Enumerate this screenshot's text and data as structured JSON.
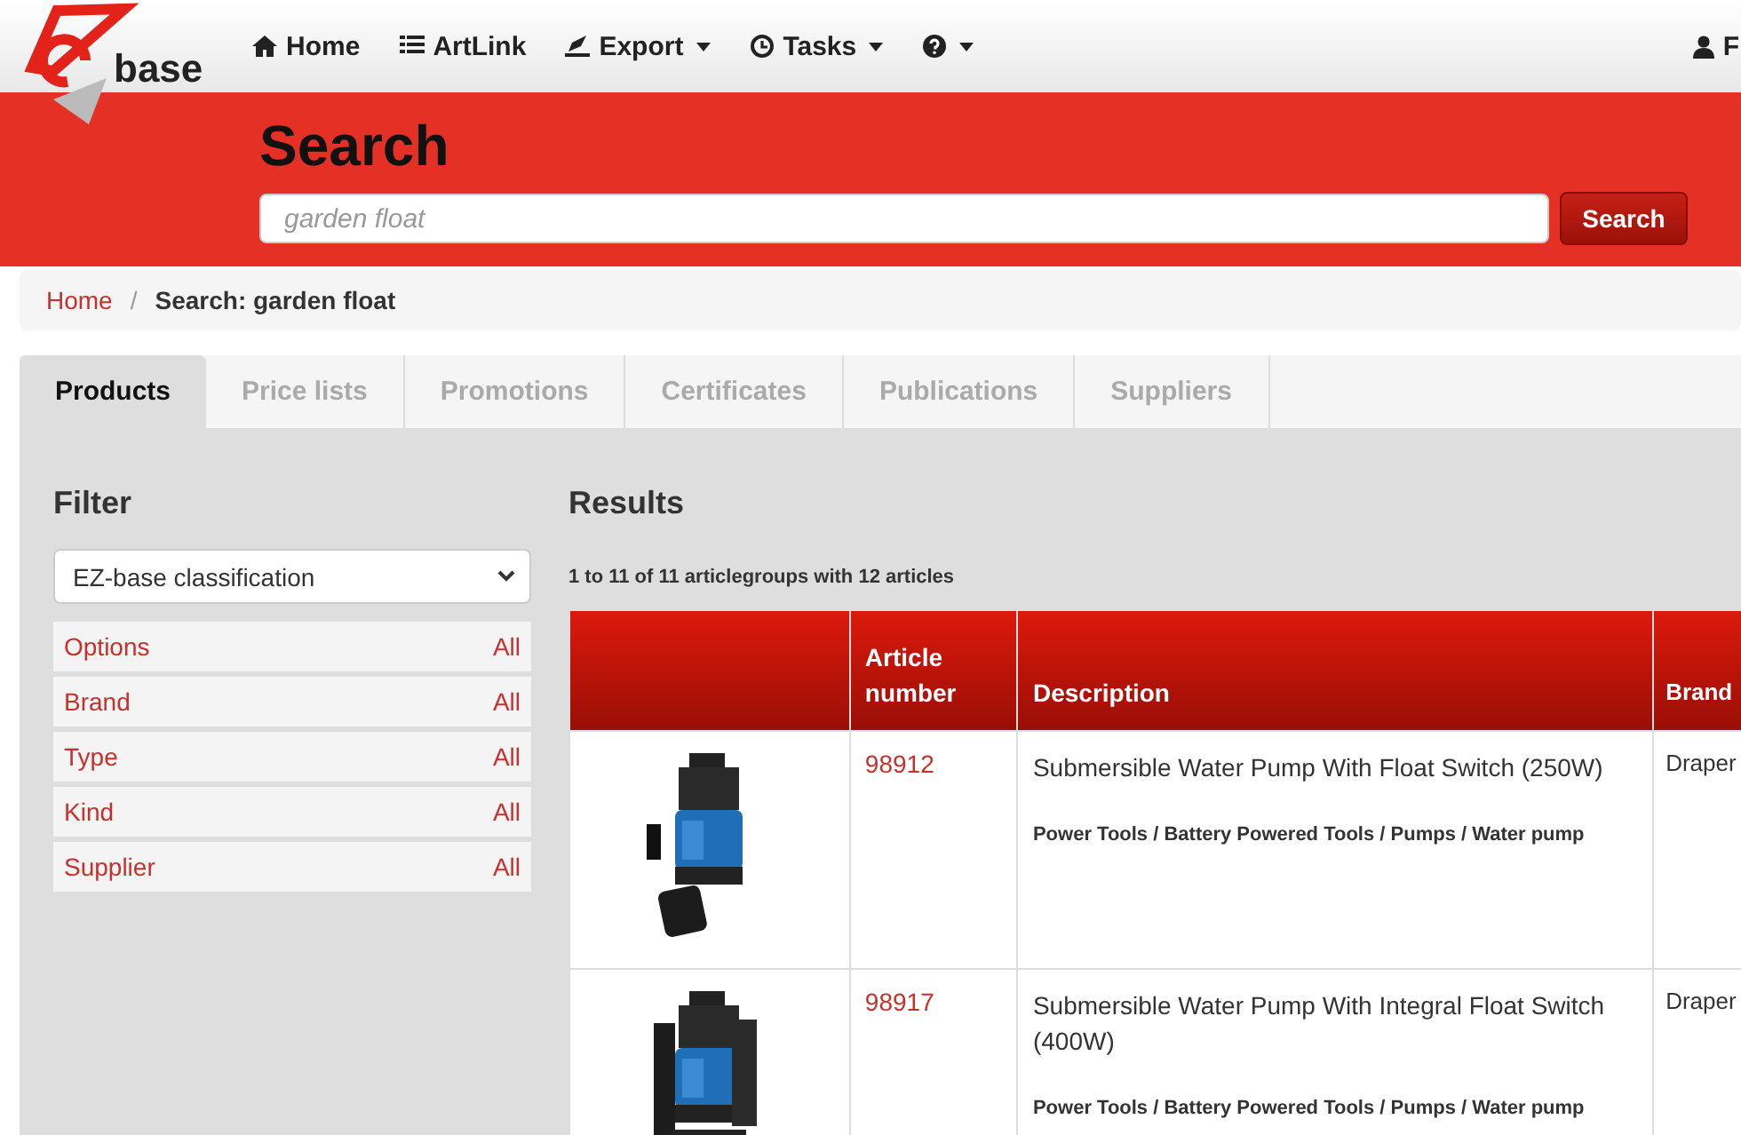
{
  "navbar": {
    "logo_text": "base",
    "items": [
      {
        "label": "Home",
        "dropdown": false
      },
      {
        "label": "ArtLink",
        "dropdown": false
      },
      {
        "label": "Export",
        "dropdown": true
      },
      {
        "label": "Tasks",
        "dropdown": true
      },
      {
        "dropdown": true
      }
    ],
    "user": "F"
  },
  "header": {
    "title": "Search",
    "search": {
      "value": "garden float",
      "button": "Search"
    }
  },
  "breadcrumb": {
    "separator": "/",
    "items": [
      {
        "label": "Home",
        "kind": "link"
      },
      {
        "label": "Search: garden float",
        "kind": "current"
      }
    ]
  },
  "tabs": [
    {
      "label": "Products",
      "selected": true
    },
    {
      "label": "Price lists",
      "selected": false
    },
    {
      "label": "Promotions",
      "selected": false
    },
    {
      "label": "Certificates",
      "selected": false
    },
    {
      "label": "Publications",
      "selected": false
    },
    {
      "label": "Suppliers",
      "selected": false
    }
  ],
  "filter": {
    "title": "Filter",
    "classification": "EZ-base classification",
    "items": [
      {
        "label": "Options",
        "value": "All"
      },
      {
        "label": "Brand",
        "value": "All"
      },
      {
        "label": "Type",
        "value": "All"
      },
      {
        "label": "Kind",
        "value": "All"
      },
      {
        "label": "Supplier",
        "value": "All"
      }
    ]
  },
  "results": {
    "title": "Results",
    "summary": "1 to 11 of 11 articlegroups with 12 articles",
    "columns": [
      "",
      "Article number",
      "Description",
      "Brand"
    ],
    "rows": [
      {
        "article_number": "98912",
        "description": "Submersible Water Pump With Float Switch (250W)",
        "category": "Power Tools / Battery Powered Tools / Pumps / Water pump",
        "brand": "Draper"
      },
      {
        "article_number": "98917",
        "description": "Submersible Water Pump With Integral Float Switch (400W)",
        "category": "Power Tools / Battery Powered Tools / Pumps / Water pump",
        "brand": "Draper"
      }
    ]
  }
}
